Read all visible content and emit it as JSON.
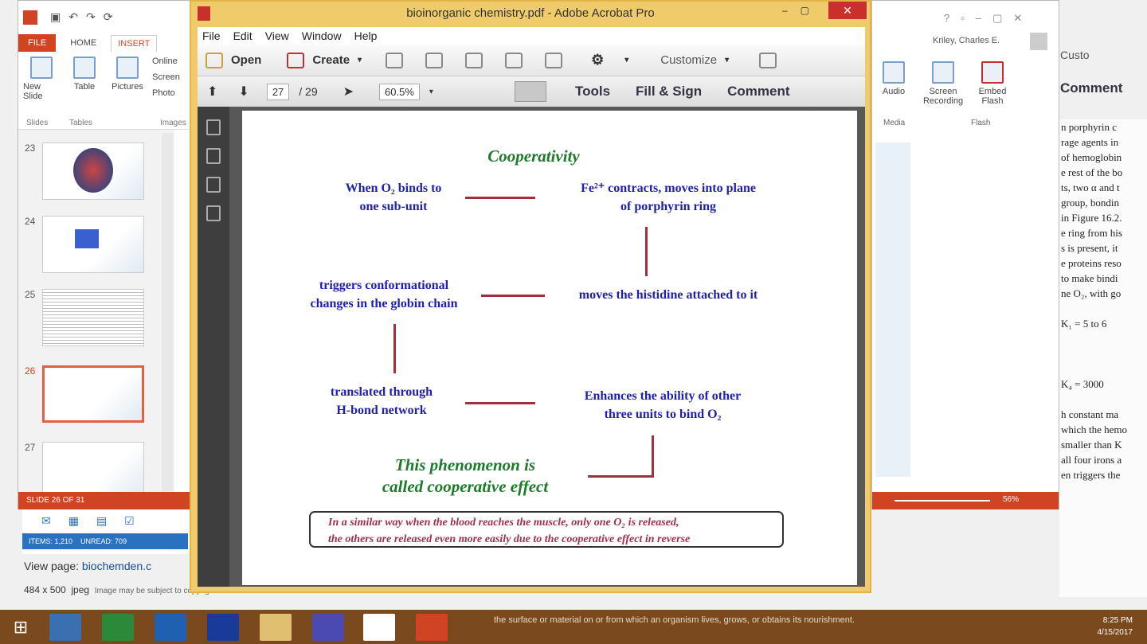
{
  "ppt": {
    "tabs": [
      "FILE",
      "HOME",
      "INSERT"
    ],
    "ribbon": [
      {
        "label": "New Slide"
      },
      {
        "label": "Table"
      },
      {
        "label": "Pictures"
      },
      {
        "label": "Online"
      },
      {
        "label": "Screen"
      },
      {
        "label": "Photo"
      }
    ],
    "groups": [
      "Slides",
      "Tables",
      "Images"
    ],
    "slides": [
      {
        "num": "23"
      },
      {
        "num": "24"
      },
      {
        "num": "25"
      },
      {
        "num": "26"
      },
      {
        "num": "27"
      }
    ],
    "status": "SLIDE 26 OF 31"
  },
  "acrobat": {
    "title": "bioinorganic chemistry.pdf - Adobe Acrobat Pro",
    "menu": [
      "File",
      "Edit",
      "View",
      "Window",
      "Help"
    ],
    "toolbar": {
      "open": "Open",
      "create": "Create",
      "customize": "Customize"
    },
    "nav": {
      "page": "27",
      "total": "/ 29",
      "zoom": "60.5%"
    },
    "panels": [
      "Tools",
      "Fill & Sign",
      "Comment"
    ]
  },
  "slide": {
    "title": "Cooperativity",
    "box1a": "When O₂ binds to",
    "box1b": "one sub-unit",
    "box2a": "Fe²⁺ contracts, moves into plane",
    "box2b": "of porphyrin ring",
    "box3": "moves the histidine attached to it",
    "box4a": "triggers conformational",
    "box4b": "changes in the globin chain",
    "box5a": "translated through",
    "box5b": "H-bond network",
    "box6a": "Enhances the ability of other",
    "box6b": "three units to bind O₂",
    "concl1": "This phenomenon is",
    "concl2": "called cooperative effect",
    "note1": "In a similar way when the blood reaches the muscle, only one O₂ is released,",
    "note2": "the others are released even more easily due to the cooperative effect in reverse"
  },
  "right": {
    "user": "Kriley, Charles E.",
    "ribbon": [
      {
        "label": "Audio"
      },
      {
        "label": "Screen Recording"
      },
      {
        "label": "Embed Flash"
      }
    ],
    "groups": [
      "Media",
      "Flash"
    ],
    "customize": "Custo",
    "comment": "Comment",
    "zoom": "56%"
  },
  "bgdoc": {
    "lines": [
      "n porphyrin c",
      "rage agents in",
      "of hemoglobin",
      "e rest of the bo",
      "ts, two α and t",
      "group, bondin",
      "in Figure 16.2.",
      "e ring from his",
      "s is present, it",
      "e proteins reso",
      "to make bindi",
      "ne O₂, with go",
      "",
      "K₁ = 5 to 6",
      "",
      "",
      "",
      "K₄ = 3000",
      "",
      "h constant ma",
      "which the hemo",
      "smaller than K",
      "all four irons a",
      "en triggers the"
    ]
  },
  "outlook": {
    "items": "ITEMS: 1,210",
    "unread": "UNREAD: 709"
  },
  "viewpage": {
    "label": "View page:",
    "link": "biochemden.c"
  },
  "imginfo": {
    "size": "484 x 500",
    "type": "jpeg",
    "note": "Image may be subject to copyright."
  },
  "taskbar": {
    "snippet": "the surface or material on or from which an organism lives, grows, or obtains its nourishment.",
    "time": "8:25 PM",
    "date": "4/15/2017"
  }
}
